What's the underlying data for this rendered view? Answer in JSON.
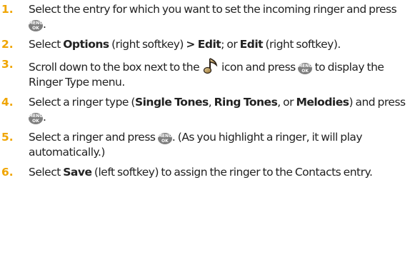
{
  "steps": [
    {
      "number": "1",
      "text_a": "Select the entry for which you want to set the incoming ringer and press ",
      "text_b": "."
    },
    {
      "number": "2",
      "text_a": "Select ",
      "options": "Options",
      "text_b": " (right softkey) ",
      "edit_path": "> Edit",
      "text_c": "; or ",
      "edit": "Edit",
      "text_d": " (right softkey)."
    },
    {
      "number": "3",
      "text_a": "Scroll down to the box next to the ",
      "text_b": " icon and press ",
      "text_c": " to display the Ringer Type menu."
    },
    {
      "number": "4",
      "text_a": "Select a ringer type (",
      "single_tones": "Single Tones",
      "sep1": ", ",
      "ring_tones": "Ring Tones",
      "sep2": ", or ",
      "melodies": "Melodies",
      "text_b": ") and press ",
      "text_c": "."
    },
    {
      "number": "5",
      "text_a": "Select a ringer and press ",
      "text_b": ". (As you highlight a ringer, it will play automatically.)"
    },
    {
      "number": "6",
      "text_a": "Select ",
      "save": "Save",
      "text_b": " (left softkey) to assign the ringer to the Contacts entry."
    }
  ],
  "menu_key": {
    "top": "MENU",
    "bottom": "OK",
    "icon": "menu-ok-key-icon",
    "color": "#7f7f7f"
  },
  "ringer_icon": "musical-note-icon",
  "number_color": "#f0a500"
}
